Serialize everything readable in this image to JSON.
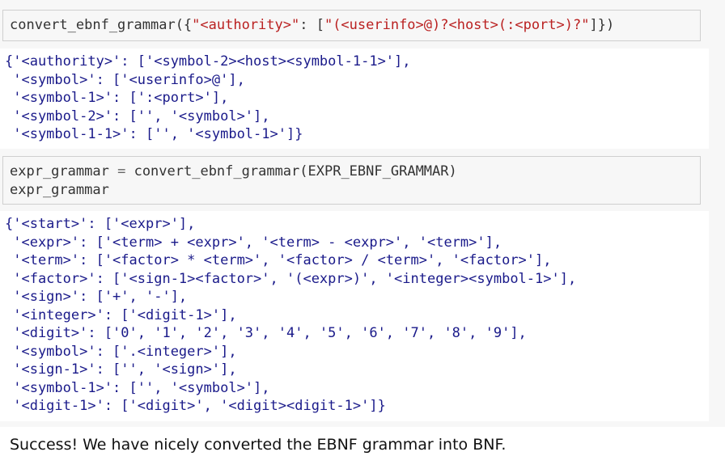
{
  "cells": [
    {
      "type": "input",
      "code_parts": {
        "prefix": "convert_ebnf_grammar({",
        "key": "\"<authority>\"",
        "middle": ": [",
        "value": "\"(<userinfo>@)?<host>(:<port>)?\"",
        "suffix": "]})"
      }
    },
    {
      "type": "output",
      "lines": [
        "{'<authority>': ['<symbol-2><host><symbol-1-1>'],",
        " '<symbol>': ['<userinfo>@'],",
        " '<symbol-1>': [':<port>'],",
        " '<symbol-2>': ['', '<symbol>'],",
        " '<symbol-1-1>': ['', '<symbol-1>']}"
      ]
    },
    {
      "type": "input",
      "line1": {
        "lhs": "expr_grammar",
        "op": "=",
        "rhs": "convert_ebnf_grammar(EXPR_EBNF_GRAMMAR)"
      },
      "line2": "expr_grammar"
    },
    {
      "type": "output",
      "lines": [
        "{'<start>': ['<expr>'],",
        " '<expr>': ['<term> + <expr>', '<term> - <expr>', '<term>'],",
        " '<term>': ['<factor> * <term>', '<factor> / <term>', '<factor>'],",
        " '<factor>': ['<sign-1><factor>', '(<expr>)', '<integer><symbol-1>'],",
        " '<sign>': ['+', '-'],",
        " '<integer>': ['<digit-1>'],",
        " '<digit>': ['0', '1', '2', '3', '4', '5', '6', '7', '8', '9'],",
        " '<symbol>': ['.<integer>'],",
        " '<sign-1>': ['', '<sign>'],",
        " '<symbol-1>': ['', '<symbol>'],",
        " '<digit-1>': ['<digit>', '<digit><digit-1>']}"
      ]
    }
  ],
  "prose": "Success! We have nicely converted the EBNF grammar into BNF."
}
